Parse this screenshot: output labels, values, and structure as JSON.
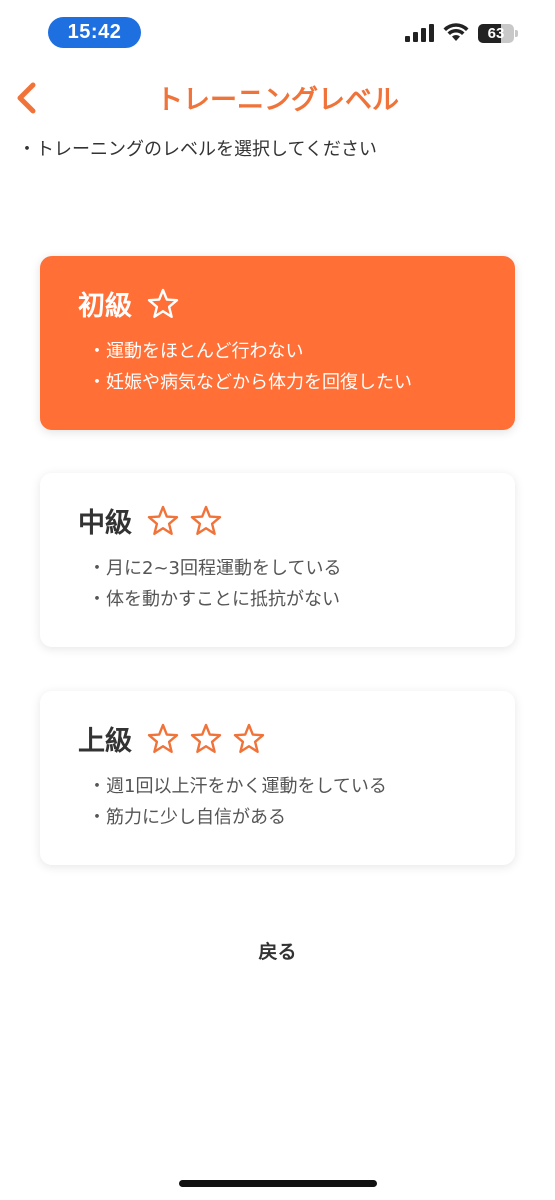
{
  "status_bar": {
    "time": "15:42",
    "battery_text": "63",
    "battery_level": 0.63
  },
  "header": {
    "back_icon": "chevron-left-icon",
    "title": "トレーニングレベル"
  },
  "instruction": "・トレーニングのレベルを選択してください",
  "colors": {
    "accent": "#f0733a",
    "selected_card": "#ff6f36",
    "time_pill": "#1e6fe0"
  },
  "levels": [
    {
      "name": "初級",
      "stars": 1,
      "selected": true,
      "points": [
        "運動をほとんど行わない",
        "妊娠や病気などから体力を回復したい"
      ]
    },
    {
      "name": "中級",
      "stars": 2,
      "selected": false,
      "points": [
        "月に2~3回程運動をしている",
        "体を動かすことに抵抗がない"
      ]
    },
    {
      "name": "上級",
      "stars": 3,
      "selected": false,
      "points": [
        "週1回以上汗をかく運動をしている",
        "筋力に少し自信がある"
      ]
    }
  ],
  "footer": {
    "back_label": "戻る"
  }
}
